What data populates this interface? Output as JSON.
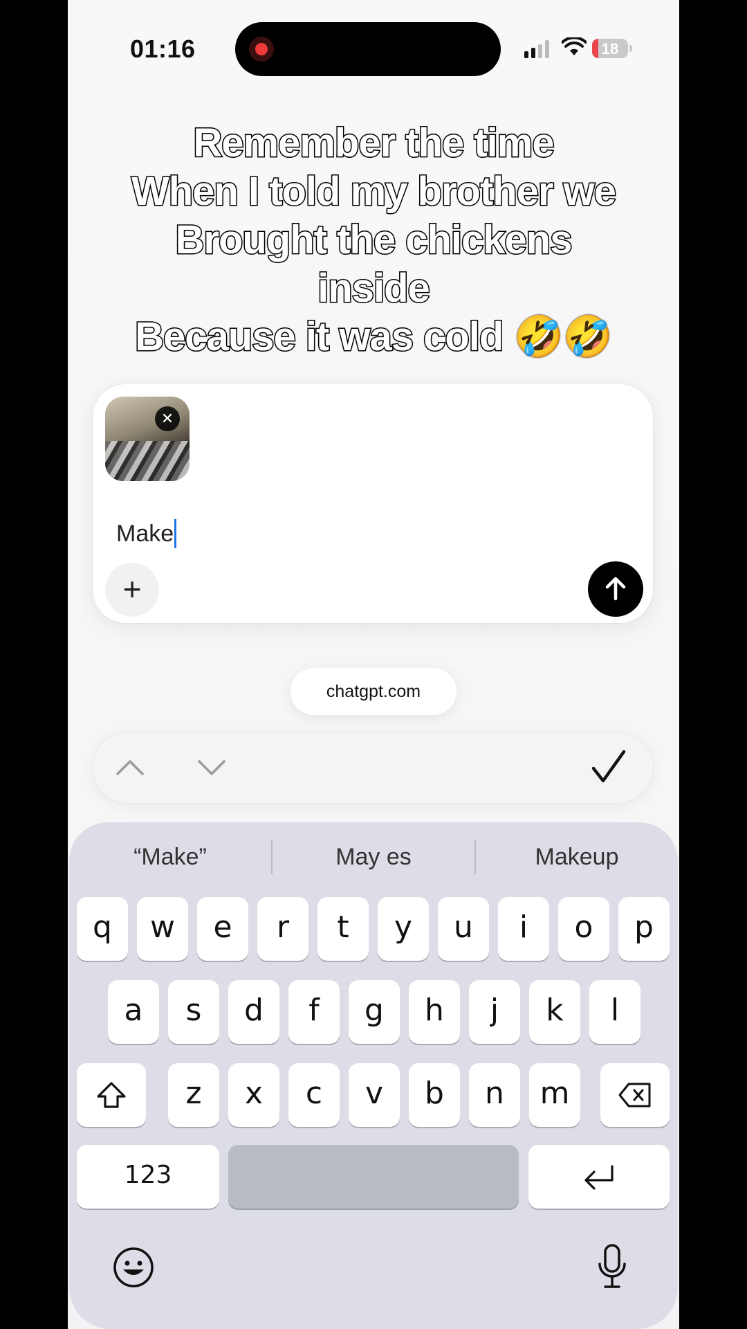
{
  "status_bar": {
    "time": "01:16",
    "battery_level": "18",
    "recording_indicator": "screen-record-icon"
  },
  "caption": {
    "lines": [
      "Remember the time",
      "When I told my brother we",
      "Brought the chickens",
      "inside",
      "Because it was cold 🤣🤣"
    ]
  },
  "composer": {
    "attachment": {
      "icon": "image-thumbnail",
      "remove_label": "✕"
    },
    "prompt_text": "Make",
    "plus_label": "+",
    "send_icon": "arrow-up-icon"
  },
  "url_pill": {
    "text": "chatgpt.com"
  },
  "accessory_bar": {
    "prev_icon": "chevron-up-icon",
    "next_icon": "chevron-down-icon",
    "done_icon": "checkmark-icon"
  },
  "keyboard": {
    "suggestions": [
      "“Make”",
      "May es",
      "Makeup"
    ],
    "row1": [
      "q",
      "w",
      "e",
      "r",
      "t",
      "y",
      "u",
      "i",
      "o",
      "p"
    ],
    "row2": [
      "a",
      "s",
      "d",
      "f",
      "g",
      "h",
      "j",
      "k",
      "l"
    ],
    "row3": [
      "z",
      "x",
      "c",
      "v",
      "b",
      "n",
      "m"
    ],
    "numbers_label": "123",
    "shift_icon": "shift-icon",
    "delete_icon": "backspace-icon",
    "return_icon": "return-icon",
    "emoji_icon": "emoji-icon",
    "dictation_icon": "microphone-icon"
  },
  "colors": {
    "accent_caret": "#1a73e8",
    "record_dot": "#f03a3a",
    "battery_low": "#e8464a",
    "keyboard_bg": "#dcdde6"
  }
}
